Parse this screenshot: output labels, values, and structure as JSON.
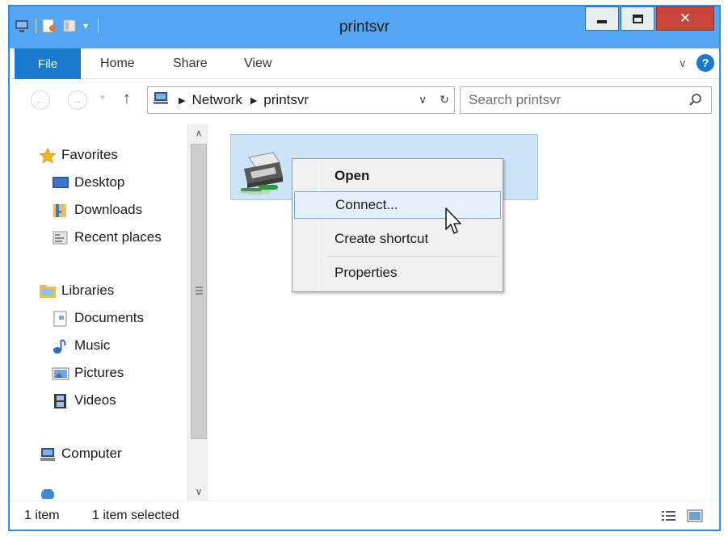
{
  "window": {
    "title": "printsvr"
  },
  "ribbon": {
    "tabs": [
      {
        "label": "File"
      },
      {
        "label": "Home"
      },
      {
        "label": "Share"
      },
      {
        "label": "View"
      }
    ]
  },
  "address": {
    "crumbs": [
      "Network",
      "printsvr"
    ],
    "search_placeholder": "Search printsvr"
  },
  "nav": {
    "favorites": {
      "label": "Favorites",
      "items": [
        "Desktop",
        "Downloads",
        "Recent places"
      ]
    },
    "libraries": {
      "label": "Libraries",
      "items": [
        "Documents",
        "Music",
        "Pictures",
        "Videos"
      ]
    },
    "computer": {
      "label": "Computer"
    }
  },
  "context_menu": {
    "items": [
      "Open",
      "Connect...",
      "Create shortcut",
      "Properties"
    ]
  },
  "status": {
    "count": "1 item",
    "selected": "1 item selected"
  },
  "colors": {
    "title_bar": "#54a6f3",
    "file_tab": "#1979ca",
    "close_button": "#c9463d",
    "selection": "#cce4f7"
  }
}
